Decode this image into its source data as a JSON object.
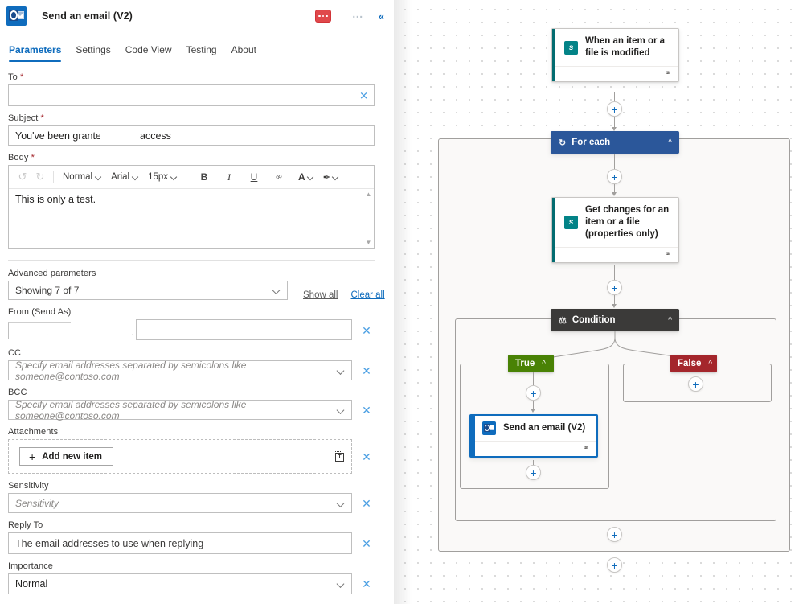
{
  "panel": {
    "app_icon": "outlook-icon",
    "title": "Send an email (V2)",
    "actions": {
      "error_button": "error-more-button",
      "more_button": "…",
      "collapse_button": "«"
    },
    "tabs": [
      {
        "label": "Parameters",
        "active": true
      },
      {
        "label": "Settings",
        "active": false
      },
      {
        "label": "Code View",
        "active": false
      },
      {
        "label": "Testing",
        "active": false
      },
      {
        "label": "About",
        "active": false
      }
    ],
    "fields": {
      "to": {
        "label": "To",
        "required": true,
        "value": "",
        "placeholder": ""
      },
      "subject": {
        "label": "Subject",
        "required": true,
        "value_part1": "You've been granted",
        "value_part2": "access"
      },
      "body": {
        "label": "Body",
        "required": true,
        "value": "This is only a test.",
        "toolbar": {
          "undo": "↺",
          "redo": "↻",
          "style": "Normal",
          "font": "Arial",
          "size": "15px",
          "bold": "B",
          "italic": "I",
          "underline": "U",
          "link": "∞",
          "font_color": "A",
          "highlight": "✒"
        }
      }
    },
    "advanced": {
      "label": "Advanced parameters",
      "selected": "Showing 7 of 7",
      "show_all": "Show all",
      "clear_all": "Clear all",
      "params": [
        {
          "label": "From (Send As)",
          "value": "",
          "redacted": true
        },
        {
          "label": "CC",
          "placeholder": "Specify email addresses separated by semicolons like someone@contoso.com"
        },
        {
          "label": "BCC",
          "placeholder": "Specify email addresses separated by semicolons like someone@contoso.com"
        },
        {
          "label": "Attachments",
          "add_button": "Add new item"
        },
        {
          "label": "Sensitivity",
          "placeholder": "Sensitivity"
        },
        {
          "label": "Reply To",
          "placeholder": "The email addresses to use when replying"
        },
        {
          "label": "Importance",
          "value": "Normal"
        }
      ]
    }
  },
  "canvas": {
    "nodes": {
      "trigger": {
        "title": "When an item or a file is modified",
        "icon": "sharepoint-icon",
        "accent": "#036c70"
      },
      "foreach": {
        "title": "For each",
        "icon": "loop-icon",
        "color": "#2b579a"
      },
      "get_changes": {
        "title": "Get changes for an item or a file (properties only)",
        "icon": "sharepoint-icon",
        "accent": "#036c70"
      },
      "condition": {
        "title": "Condition",
        "icon": "condition-icon",
        "color": "#3b3a39"
      },
      "branch_true": {
        "label": "True",
        "color": "#498205"
      },
      "branch_false": {
        "label": "False",
        "color": "#a4262c"
      },
      "send_email": {
        "title": "Send an email (V2)",
        "icon": "outlook-icon",
        "selected": true,
        "accent": "#0f6cbd"
      }
    },
    "add_button_label": "+"
  }
}
